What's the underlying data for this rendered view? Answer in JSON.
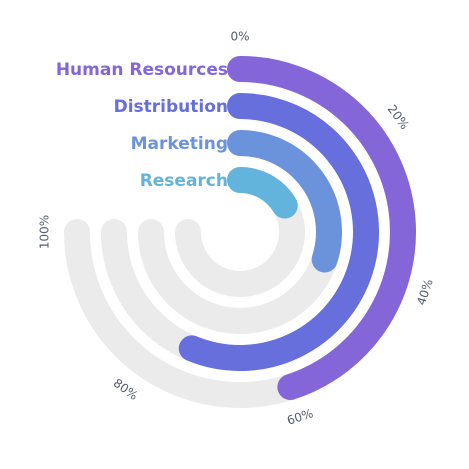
{
  "chart_data": {
    "type": "radial-bar",
    "categories": [
      "Human Resources",
      "Distribution",
      "Marketing",
      "Research"
    ],
    "values": [
      60,
      75,
      40,
      22
    ],
    "colors": [
      "#8466d9",
      "#666fdc",
      "#6a93dc",
      "#62b4dc"
    ],
    "track_color": "#ebebeb",
    "axis": {
      "min": 0,
      "max": 100,
      "unit": "%",
      "ticks": [
        0,
        20,
        40,
        60,
        80,
        100
      ],
      "tick_labels": [
        "0%",
        "20%",
        "40%",
        "60%",
        "80%",
        "100%"
      ]
    },
    "title": "",
    "legend": "none"
  }
}
